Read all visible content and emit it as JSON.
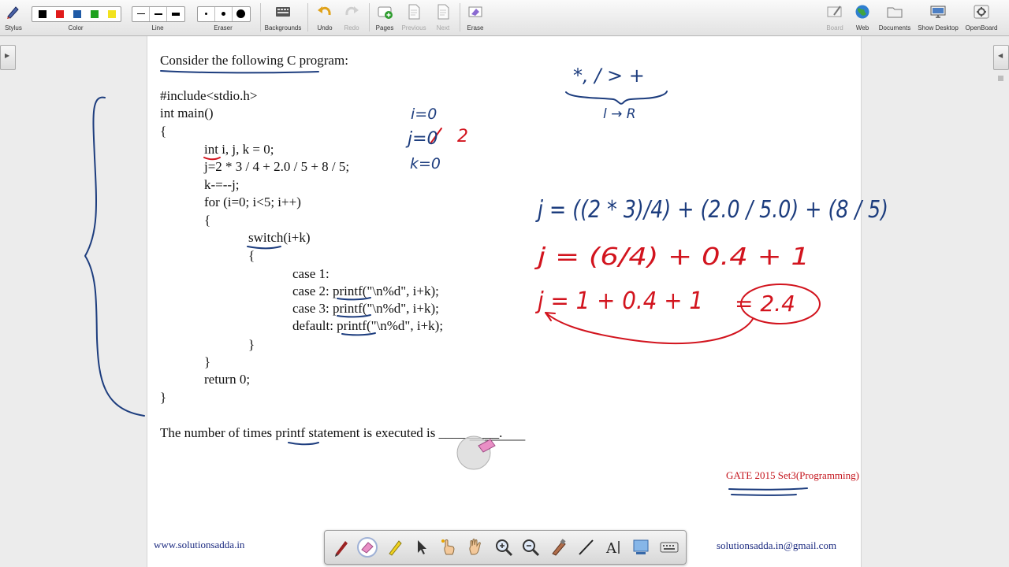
{
  "toolbar": {
    "stylus": "Stylus",
    "color": "Color",
    "line": "Line",
    "eraser": "Eraser",
    "backgrounds": "Backgrounds",
    "undo": "Undo",
    "redo": "Redo",
    "pages": "Pages",
    "previous": "Previous",
    "next": "Next",
    "erase": "Erase",
    "board": "Board",
    "web": "Web",
    "documents": "Documents",
    "show_desktop": "Show Desktop",
    "openboard": "OpenBoard",
    "swatch_colors": [
      "#000000",
      "#e01b1b",
      "#1f5aa6",
      "#1ea11e",
      "#f2e21e"
    ]
  },
  "page": {
    "question": "Consider the following C program:",
    "code_lines": [
      "#include<stdio.h>",
      "int main()",
      "{",
      "int i, j, k = 0;",
      "j=2 * 3 / 4 + 2.0 / 5 + 8 / 5;",
      "k-=--j;",
      "for (i=0; i<5; i++)",
      "{",
      "switch(i+k)",
      "{",
      "case 1:",
      "case 2: printf(\"\\n%d\", i+k);",
      "case 3: printf(\"\\n%d\", i+k);",
      "default: printf(\"\\n%d\", i+k);",
      "}",
      "}",
      "return 0;",
      "}"
    ],
    "prompt": "The number of times printf statement is executed is _________.",
    "source_tag": "GATE 2015 Set3(Programming)",
    "website": "www.solutionsadda.in",
    "email": "solutionsadda.in@gmail.com"
  },
  "handwriting": {
    "precedence": "*, / > +",
    "assoc": "l → R",
    "vars": [
      "i=0",
      "j=0",
      "2",
      "k=0"
    ],
    "eq1": "j = ((2 * 3)/4) + (2.0 / 5.0) + (8 / 5)",
    "eq2": "j = (6/4) + 0.4 + 1",
    "eq3": "j = 1 + 0.4 + 1",
    "result": "= 2.4"
  },
  "colors": {
    "ink_blue": "#1d3d7e",
    "ink_red": "#d2141e"
  }
}
